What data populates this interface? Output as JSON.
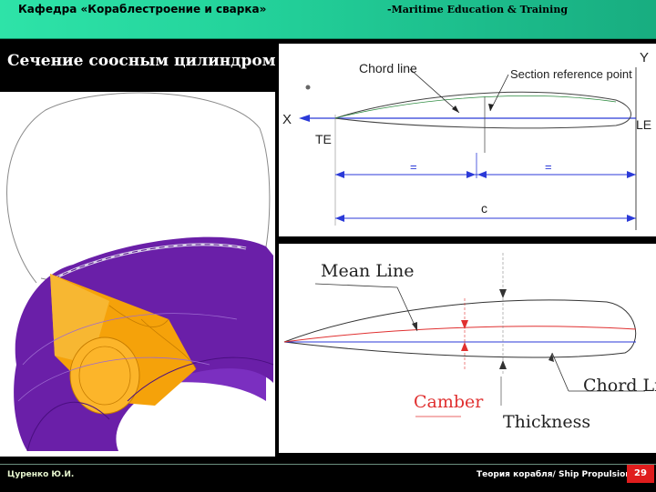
{
  "header": {
    "department": "Кафедра «Кораблестроение и сварка»",
    "subtitle": "-Maritime Education & Training"
  },
  "slide": {
    "title": "Сечение соосным цилиндром"
  },
  "diagram_top": {
    "chord_line": "Chord line",
    "section_reference_point": "Section reference point",
    "y_axis": "Y",
    "x_axis": "X",
    "te": "TE",
    "le": "LE",
    "equal_left": "=",
    "equal_right": "=",
    "chord_length": "c"
  },
  "diagram_bottom": {
    "mean_line": "Mean Line",
    "chord_line": "Chord Line",
    "camber": "Camber",
    "thickness": "Thickness"
  },
  "footer": {
    "author": "Цуренко Ю.И.",
    "course": "Теория корабля/ Ship Propulsion",
    "page": "29"
  },
  "colors": {
    "header_green": "#24d49c",
    "propeller_purple": "#6a1fa8",
    "hub_orange": "#f5a20a",
    "axis_blue": "#2b3ad8",
    "mean_red": "#e03030",
    "page_badge": "#e01d1d"
  }
}
